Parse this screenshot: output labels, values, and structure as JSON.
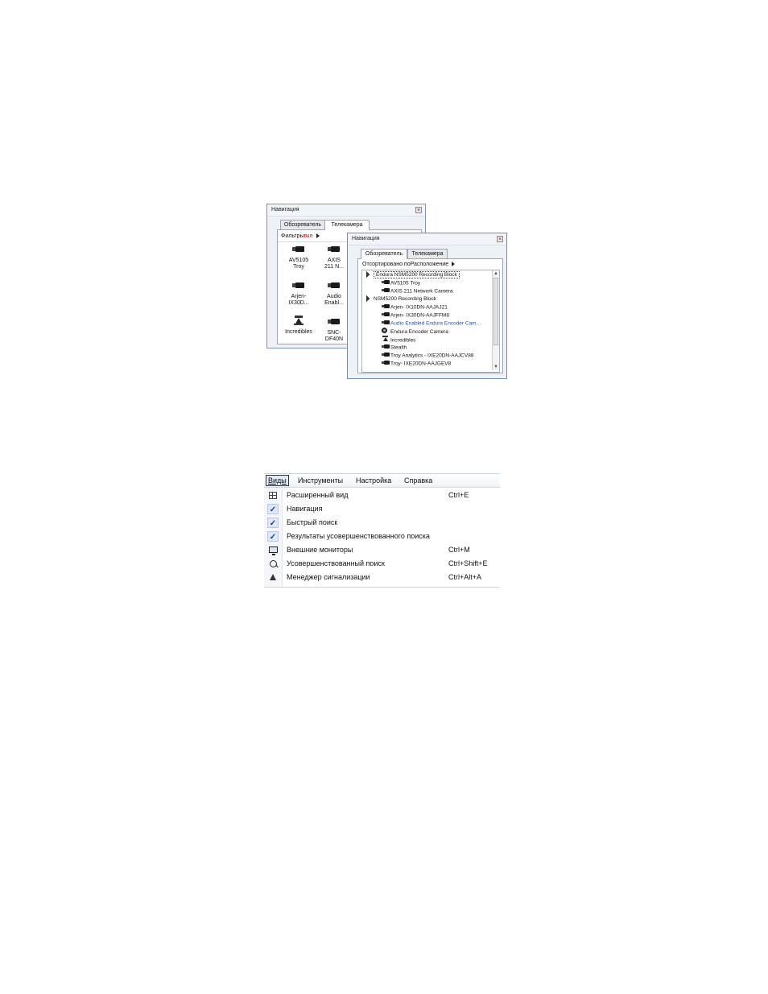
{
  "nav_back": {
    "title": "Навигация",
    "tabs": [
      "Обозреватель",
      "Телекамера"
    ],
    "filter_label": "Фильтры",
    "filter_state": "вкл",
    "cameras": [
      {
        "label": "AV5105\nTroy",
        "icon": "camera-icon"
      },
      {
        "label": "AXIS\n211 N...",
        "icon": "camera-icon"
      },
      {
        "label": "Arjen-\nIX30D...",
        "icon": "camera-icon"
      },
      {
        "label": "Audio\nEnabl...",
        "icon": "camera-icon"
      },
      {
        "label": "Incredibles",
        "icon": "ptz-camera-icon"
      },
      {
        "label": "SNC-\nDF40N",
        "icon": "camera-icon"
      }
    ]
  },
  "nav_front": {
    "title": "Навигация",
    "tabs": [
      "Обозреватель",
      "Телекамера"
    ],
    "sort_label": "Отсортировано поРасположение",
    "tree": [
      {
        "label": "Endura NSM5200 Recording Block",
        "level": 0,
        "type": "group"
      },
      {
        "label": "AV5105 Troy",
        "level": 1,
        "type": "camera"
      },
      {
        "label": "AXIS 211 Network Camera",
        "level": 1,
        "type": "camera"
      },
      {
        "label": "NSM5200 Recording Block",
        "level": 0,
        "type": "group"
      },
      {
        "label": "Arjen- IX10DN-AAJAJ21",
        "level": 1,
        "type": "camera"
      },
      {
        "label": "Arjen- IX30DN-AAJFFM8",
        "level": 1,
        "type": "camera"
      },
      {
        "label": "Audio Enabled Endura Encoder Cam...",
        "level": 1,
        "type": "camera",
        "selected": true
      },
      {
        "label": "Endura Encoder Camera",
        "level": 1,
        "type": "encoder"
      },
      {
        "label": "Incredibles",
        "level": 1,
        "type": "ptz"
      },
      {
        "label": "Stealth",
        "level": 1,
        "type": "camera"
      },
      {
        "label": "Troy Analytics - IXE20DN-AAJCV88",
        "level": 1,
        "type": "camera"
      },
      {
        "label": "Troy- IXE20DN-AAJGEV8",
        "level": 1,
        "type": "camera"
      }
    ]
  },
  "menu": {
    "menubar": [
      "Виды",
      "Инструменты",
      "Настройка",
      "Справка"
    ],
    "items": [
      {
        "label": "Расширенный вид",
        "shortcut": "Ctrl+E",
        "icon": "grid-view-icon"
      },
      {
        "label": "Навигация",
        "shortcut": "",
        "icon": "check-icon"
      },
      {
        "label": "Быстрый поиск",
        "shortcut": "",
        "icon": "check-icon"
      },
      {
        "label": "Результаты усовершенствованного поиска",
        "shortcut": "",
        "icon": "check-icon"
      },
      {
        "label": "Внешние мониторы",
        "shortcut": "Ctrl+M",
        "icon": "monitor-icon"
      },
      {
        "label": "Усовершенствованный поиск",
        "shortcut": "Ctrl+Shift+E",
        "icon": "advanced-search-icon"
      },
      {
        "label": "Менеджер сигнализации",
        "shortcut": "Ctrl+Alt+A",
        "icon": "bell-icon"
      }
    ]
  }
}
